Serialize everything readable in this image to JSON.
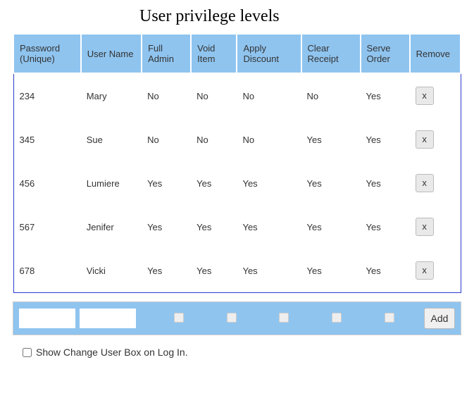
{
  "title": "User privilege levels",
  "columns": [
    "Password (Unique)",
    "User Name",
    "Full Admin",
    "Void Item",
    "Apply Discount",
    "Clear Receipt",
    "Serve Order",
    "Remove"
  ],
  "rows": [
    {
      "password": "234",
      "user": "Mary",
      "full_admin": "No",
      "void_item": "No",
      "apply_discount": "No",
      "clear_receipt": "No",
      "serve_order": "Yes"
    },
    {
      "password": "345",
      "user": "Sue",
      "full_admin": "No",
      "void_item": "No",
      "apply_discount": "No",
      "clear_receipt": "Yes",
      "serve_order": "Yes"
    },
    {
      "password": "456",
      "user": "Lumiere",
      "full_admin": "Yes",
      "void_item": "Yes",
      "apply_discount": "Yes",
      "clear_receipt": "Yes",
      "serve_order": "Yes"
    },
    {
      "password": "567",
      "user": "Jenifer",
      "full_admin": "Yes",
      "void_item": "Yes",
      "apply_discount": "Yes",
      "clear_receipt": "Yes",
      "serve_order": "Yes"
    },
    {
      "password": "678",
      "user": "Vicki",
      "full_admin": "Yes",
      "void_item": "Yes",
      "apply_discount": "Yes",
      "clear_receipt": "Yes",
      "serve_order": "Yes"
    }
  ],
  "remove_button_label": "x",
  "add_button_label": "Add",
  "option_text": "Show Change User Box on Log In."
}
